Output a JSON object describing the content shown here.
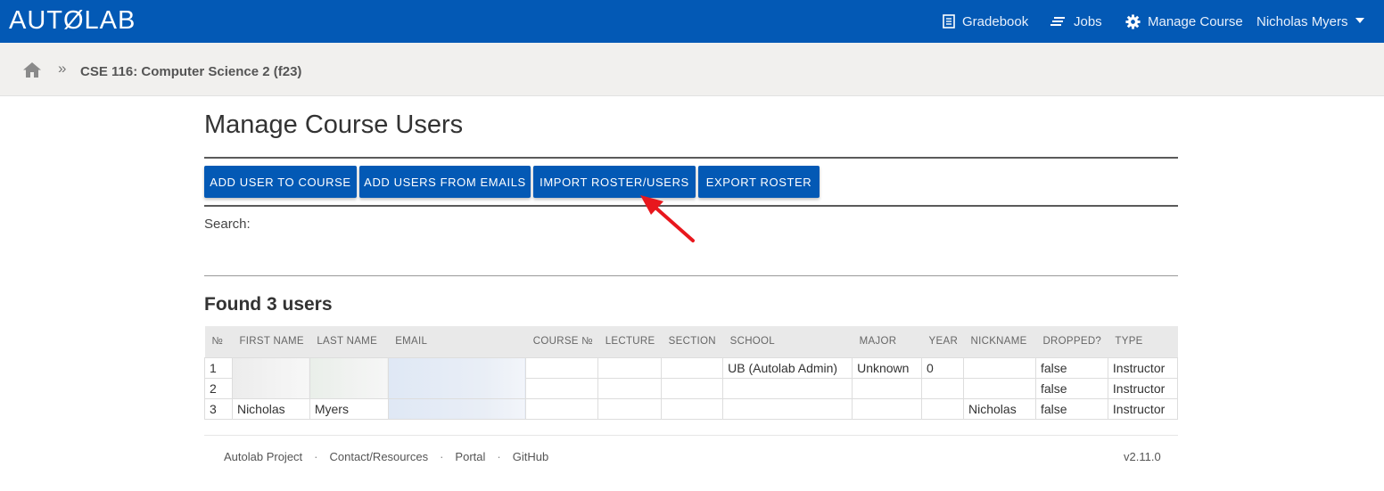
{
  "brand": {
    "logo_text": "AUTØLAB"
  },
  "nav": {
    "items": [
      {
        "label": "Gradebook",
        "icon": "gradebook-icon"
      },
      {
        "label": "Jobs",
        "icon": "jobs-icon"
      },
      {
        "label": "Manage Course",
        "icon": "gear-icon"
      }
    ],
    "user": "Nicholas Myers"
  },
  "breadcrumb": {
    "home_icon": "home-icon",
    "separator": "»",
    "course": "CSE 116: Computer Science 2 (f23)"
  },
  "main": {
    "title": "Manage Course Users",
    "buttons": {
      "add_user": "ADD USER TO COURSE",
      "add_emails": "ADD USERS FROM EMAILS",
      "import_roster": "IMPORT ROSTER/USERS",
      "export_roster": "EXPORT ROSTER"
    },
    "search_label": "Search:",
    "found_text": "Found 3 users"
  },
  "table": {
    "headers": {
      "num": "№",
      "first": "FIRST NAME",
      "last": "LAST NAME",
      "email": "EMAIL",
      "course_num": "COURSE №",
      "lecture": "LECTURE",
      "section": "SECTION",
      "school": "SCHOOL",
      "major": "MAJOR",
      "year": "YEAR",
      "nickname": "NICKNAME",
      "dropped": "DROPPED?",
      "type": "TYPE"
    },
    "rows": [
      {
        "num": "1",
        "first": "",
        "last": "",
        "email": "",
        "course_num": "",
        "lecture": "",
        "section": "",
        "school": "UB (Autolab Admin)",
        "major": "Unknown",
        "year": "0",
        "nickname": "",
        "dropped": "false",
        "type": "Instructor"
      },
      {
        "num": "2",
        "first": "",
        "last": "",
        "email": "",
        "course_num": "",
        "lecture": "",
        "section": "",
        "school": "",
        "major": "",
        "year": "",
        "nickname": "",
        "dropped": "false",
        "type": "Instructor"
      },
      {
        "num": "3",
        "first": "Nicholas",
        "last": "Myers",
        "email": "",
        "course_num": "",
        "lecture": "",
        "section": "",
        "school": "",
        "major": "",
        "year": "",
        "nickname": "Nicholas",
        "dropped": "false",
        "type": "Instructor"
      }
    ]
  },
  "footer": {
    "links": [
      "Autolab Project",
      "Contact/Resources",
      "Portal",
      "GitHub"
    ],
    "separator": "·",
    "version": "v2.11.0"
  },
  "colors": {
    "brand_blue": "#0359b5",
    "breadcrumb_bg": "#f1f0ee",
    "annotation_arrow": "#e8171d"
  }
}
